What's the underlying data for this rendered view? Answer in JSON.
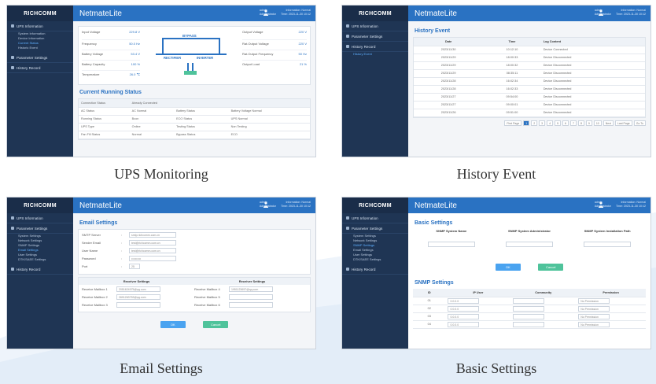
{
  "brand": {
    "logo": "RICHCOMM",
    "app": "NetmateLite"
  },
  "user": {
    "name": "admin",
    "role": "Administrator"
  },
  "info": {
    "line1": "Information: Normal",
    "line2": "Time: 2023-11-30 10:12"
  },
  "colors": {
    "sidebar": "#1f3554",
    "topbar": "#2a72c2",
    "accent": "#2a72c2",
    "ok": "#4aa3f0",
    "cancel": "#4fc39b"
  },
  "captions": {
    "ups": "UPS Monitoring",
    "history": "History Event",
    "email": "Email Settings",
    "basic": "Basic Settings"
  },
  "sidebar": {
    "ups_info": "UPS Information",
    "ups_subs": [
      "System Information",
      "Device Information",
      "Current Status",
      "Historic Event"
    ],
    "parameter": "Parameter Settings",
    "param_subs": [
      "System Settings",
      "Network Settings",
      "SNMP Settings",
      "Email Settings",
      "User Settings",
      "DTK/SAEE Settings"
    ],
    "history": "History Record",
    "history_subs": [
      "History Event"
    ]
  },
  "ups": {
    "metrics_left": [
      {
        "label": "Input Voltage",
        "value": "229.8 V"
      },
      {
        "label": "Frequency",
        "value": "50.0 Hz"
      },
      {
        "label": "Battery Voltage",
        "value": "53.4 V"
      },
      {
        "label": "Battery Capacity",
        "value": "100 %"
      },
      {
        "label": "Temperature",
        "value": "26.0 ℃"
      }
    ],
    "metrics_right": [
      {
        "label": "Output Voltage",
        "value": "220 V"
      },
      {
        "label": "Rat.Output Voltage",
        "value": "220 V"
      },
      {
        "label": "Rat.Output Frequency",
        "value": "50 Hz"
      },
      {
        "label": "Output Load",
        "value": "21 %"
      }
    ],
    "diagram": {
      "bypass": "BYPASS",
      "rectifier": "RECTIFIER",
      "inverter": "INVERTER"
    },
    "status_title": "Current Running Status",
    "status_header": {
      "label": "Connection Status",
      "value": "Already Connected"
    },
    "status_rows": [
      [
        "AC Status",
        "AC Normal",
        "Battery Status",
        "Battery Voltage Normal"
      ],
      [
        "Running Status",
        "Bcon",
        "ECO Status",
        "UPS Normal"
      ],
      [
        "UPS Type",
        "Online",
        "Testing Status",
        "Non Testing"
      ],
      [
        "Fan Fill Status",
        "Normal",
        "Bypass Status",
        "ECO"
      ]
    ]
  },
  "history": {
    "title": "History Event",
    "columns": [
      "Date",
      "Time",
      "Log Content"
    ],
    "rows": [
      [
        "2023/11/30",
        "10:12:10",
        "Device Connected"
      ],
      [
        "2023/11/29",
        "18:00:33",
        "Device Disconnected"
      ],
      [
        "2023/11/29",
        "18:00:32",
        "Device Disconnected"
      ],
      [
        "2023/11/29",
        "08:35:11",
        "Device Disconnected"
      ],
      [
        "2023/11/28",
        "16:02:34",
        "Device Disconnected"
      ],
      [
        "2023/11/28",
        "16:02:33",
        "Device Disconnected"
      ],
      [
        "2023/11/27",
        "09:54:00",
        "Device Disconnected"
      ],
      [
        "2023/11/27",
        "09:00:01",
        "Device Disconnected"
      ],
      [
        "2023/11/26",
        "09:51:00",
        "Device Disconnected"
      ]
    ],
    "pager": [
      "First Page",
      "1",
      "2",
      "3",
      "4",
      "5",
      "6",
      "7",
      "8",
      "9",
      "10",
      "Next",
      "Last Page",
      "Go To"
    ]
  },
  "email": {
    "title": "Email Settings",
    "fields": [
      {
        "label": "SMTP Server",
        "value": "smtp.richcomm.com.cn"
      },
      {
        "label": "Sender Email",
        "value": "test@richcomm.com.cn"
      },
      {
        "label": "User Name",
        "value": "test@richcomm.com.cn"
      },
      {
        "label": "Password",
        "value": "••••••••••"
      },
      {
        "label": "Port",
        "value": "25"
      }
    ],
    "receiver_header": "Receiver Settings",
    "receivers_left": [
      {
        "label": "Receive Mailbox 1",
        "value": "2051624975@qq.com"
      },
      {
        "label": "Receive Mailbox 2",
        "value": "2691263753@qq.com"
      },
      {
        "label": "Receive Mailbox 3",
        "value": ""
      }
    ],
    "receivers_right": [
      {
        "label": "Receive Mailbox 4",
        "value": "1951123657@qq.com"
      },
      {
        "label": "Receive Mailbox 5",
        "value": ""
      },
      {
        "label": "Receive Mailbox 6",
        "value": ""
      }
    ],
    "ok": "OK",
    "cancel": "Cancel"
  },
  "basic": {
    "title": "Basic Settings",
    "columns": [
      "SNMP System Name",
      "SNMP System Administrator",
      "SNMP System Installation Path"
    ],
    "ok": "OK",
    "cancel": "Cancel",
    "snmp_title": "SNMP Settings",
    "snmp_columns": [
      "ID",
      "IP User",
      "Community",
      "Permission"
    ],
    "snmp_rows": [
      {
        "id": "01",
        "ip": "0.0.0.0",
        "community": "",
        "permission": "No Permission"
      },
      {
        "id": "02",
        "ip": "0.0.0.0",
        "community": "",
        "permission": "No Permission"
      },
      {
        "id": "03",
        "ip": "0.0.0.0",
        "community": "",
        "permission": "No Permission"
      },
      {
        "id": "04",
        "ip": "0.0.0.0",
        "community": "",
        "permission": "No Permission"
      }
    ]
  }
}
